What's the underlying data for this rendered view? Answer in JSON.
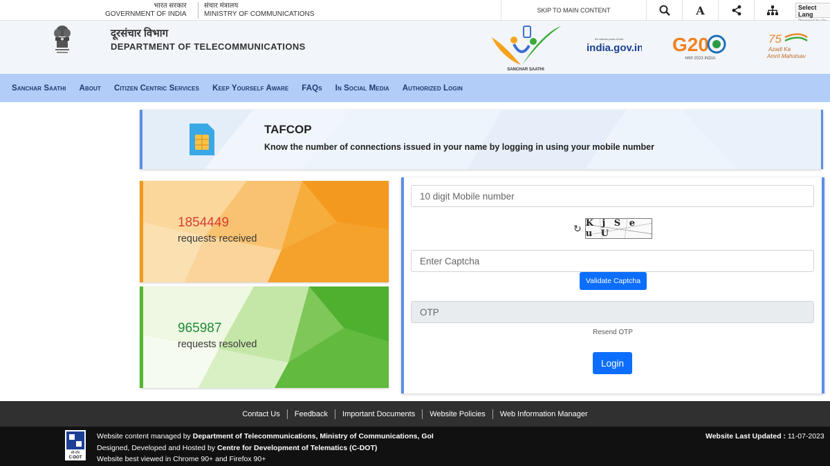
{
  "topbar": {
    "gov_hi": "भारत सरकार",
    "gov_en": "GOVERNMENT OF INDIA",
    "ministry_hi": "संचार मंत्रालय",
    "ministry_en": "MINISTRY OF COMMUNICATIONS",
    "skip": "SKIP TO MAIN CONTENT",
    "font_icon": "A",
    "language": "Select Lang",
    "language_powered": "Powered by Go"
  },
  "header": {
    "dept_hi": "दूरसंचार विभाग",
    "dept_en": "DEPARTMENT OF TELECOMMUNICATIONS",
    "saathi_logo": "SANCHAR SAATHI",
    "india_logo": "india.gov.in",
    "india_logo_sub": "the national portal of india",
    "g20_logo": "G20",
    "g20_sub": "भारत 2023 INDIA",
    "azadi_75": "75",
    "azadi_line1": "Azadi Ka",
    "azadi_line2": "Amrit Mahotsav"
  },
  "nav": {
    "items": [
      "Sanchar Saathi",
      "About",
      "Citizen Centric Services",
      "Keep Yourself Aware",
      "FAQs",
      "In Social Media",
      "Authorized Login"
    ]
  },
  "banner": {
    "title": "TAFCOP",
    "subtitle": "Know the number of connections issued in your name by logging in using your mobile number"
  },
  "stats": {
    "received_value": "1854449",
    "received_label": "requests received",
    "resolved_value": "965987",
    "resolved_label": "requests resolved"
  },
  "login": {
    "mobile_placeholder": "10 digit Mobile number",
    "captcha_text": "K j S e u U",
    "captcha_placeholder": "Enter Captcha",
    "validate_label": "Validate Captcha",
    "otp_placeholder": "OTP",
    "resend_label": "Resend OTP",
    "login_label": "Login"
  },
  "footer": {
    "links": [
      "Contact Us",
      "Feedback",
      "Important Documents",
      "Website Policies",
      "Web Information Manager"
    ],
    "managed_prefix": "Website content managed by ",
    "managed_by": "Department of Telecommunications, Ministry of Communications, GoI",
    "designed_prefix": "Designed, Developed and Hosted by ",
    "designed_by": "Centre for Development of Telematics (C-DOT)",
    "best_viewed": "Website best viewed in Chrome 90+ and Firefox 90+",
    "updated_label": "Website Last Updated : ",
    "updated_value": "11-07-2023",
    "cdot_hi": "सी-डॉट",
    "cdot_en": "C-DOT"
  },
  "colors": {
    "nav_bg": "#b3cdf9",
    "accent_blue": "#5b8ee6",
    "button_blue": "#0d6efd",
    "received_red": "#d83e33",
    "resolved_green": "#1f8a36"
  }
}
